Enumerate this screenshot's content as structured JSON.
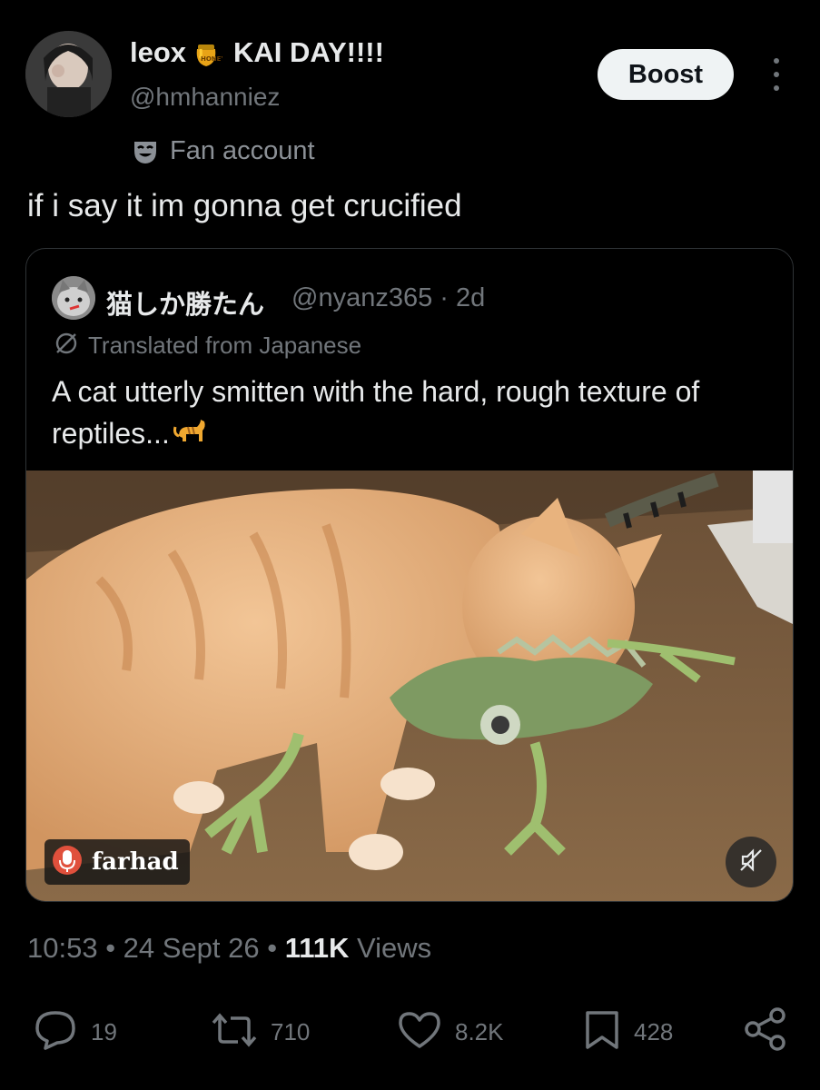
{
  "author": {
    "display_name": "leox",
    "display_suffix": "KAI DAY!!!!",
    "handle": "@hmhanniez",
    "label": "Fan account",
    "emoji_icon": "honey-pot-icon"
  },
  "boost_label": "Boost",
  "tweet_text": "if i say it im gonna get crucified",
  "quoted": {
    "name": "猫しか勝たん",
    "handle_time": "@nyanz365 · 2d",
    "translated_label": "Translated from Japanese",
    "text": "A cat utterly smitten with the hard, rough texture of reptiles...",
    "emoji_icon": "cat-icon",
    "watermark": "farhad"
  },
  "meta": {
    "time": "10:53",
    "sep1": " • ",
    "date": "24 Sept 26",
    "sep2": " • ",
    "views_count": "111K",
    "views_label": " Views"
  },
  "actions": {
    "replies": "19",
    "reposts": "710",
    "likes": "8.2K",
    "bookmarks": "428"
  },
  "colors": {
    "background": "#000000",
    "text": "#e7e9ea",
    "muted": "#71767b",
    "button_bg": "#eff3f4"
  }
}
